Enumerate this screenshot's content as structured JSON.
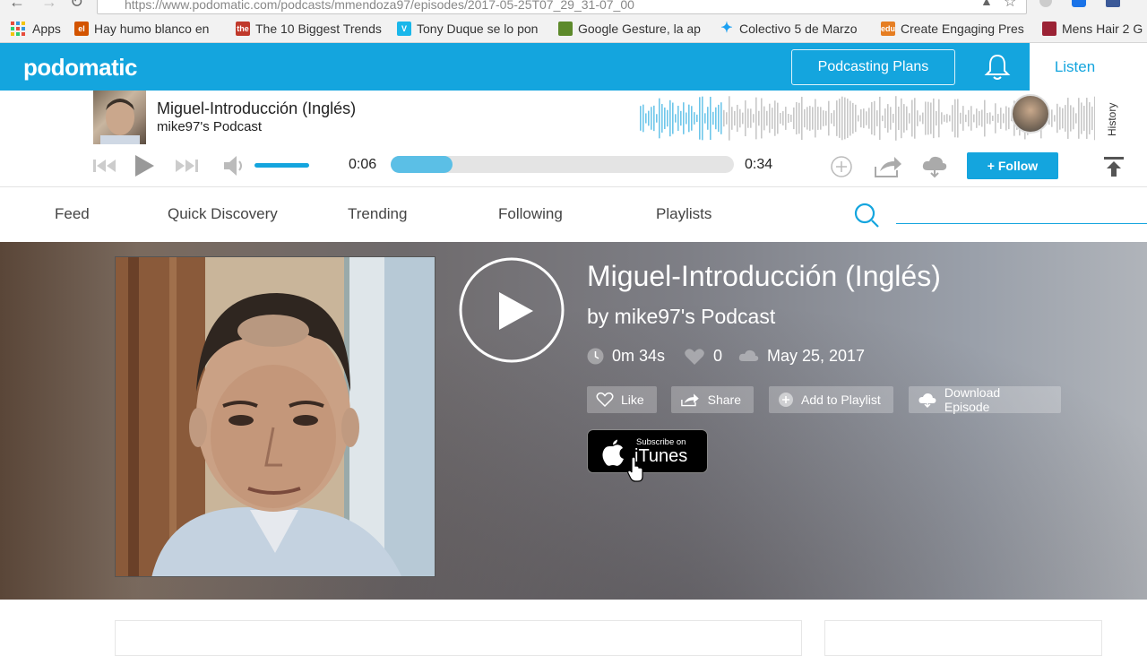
{
  "browser": {
    "url": "https://www.podomatic.com/podcasts/mmendoza97/episodes/2017-05-25T07_29_31-07_00",
    "bookmarks": [
      {
        "label": "Apps",
        "icon": "apps-grid-icon",
        "color": "#4285f4"
      },
      {
        "label": "Hay humo blanco en",
        "icon": "el-favicon",
        "color": "#d35400"
      },
      {
        "label": "The 10 Biggest Trends",
        "icon": "the-favicon",
        "color": "#c0392b"
      },
      {
        "label": "Tony Duque se lo pon",
        "icon": "vimeo-icon",
        "color": "#1ab7ea"
      },
      {
        "label": "Google Gesture, la ap",
        "icon": "app-favicon",
        "color": "#5d8a2b"
      },
      {
        "label": "Colectivo 5 de Marzo",
        "icon": "twitter-icon",
        "color": "#1da1f2"
      },
      {
        "label": "Create Engaging Pres",
        "icon": "edu-favicon",
        "color": "#e67e22"
      },
      {
        "label": "Mens Hair 2 G",
        "icon": "mens-hair-favicon",
        "color": "#9b2335"
      }
    ]
  },
  "header": {
    "logo": "podomatic",
    "plans_label": "Podcasting Plans",
    "listen_label": "Listen"
  },
  "mini_player": {
    "title": "Miguel-Introducción (Inglés)",
    "podcast": "mike97's Podcast",
    "history_label": "History"
  },
  "controls": {
    "current_time": "0:06",
    "end_time": "0:34",
    "progress": 0.18,
    "volume": 1.0,
    "follow_label": "+ Follow"
  },
  "nav": {
    "items": [
      "Feed",
      "Quick Discovery",
      "Trending",
      "Following",
      "Playlists"
    ],
    "search_placeholder": ""
  },
  "episode": {
    "title": "Miguel-Introducción (Inglés)",
    "by_line": "by mike97's Podcast",
    "duration": "0m 34s",
    "likes": "0",
    "date": "May 25, 2017",
    "actions": {
      "like": "Like",
      "share": "Share",
      "add_to_playlist": "Add to Playlist",
      "download": "Download Episode"
    },
    "itunes": {
      "small": "Subscribe on",
      "big": "iTunes"
    }
  },
  "colors": {
    "brand": "#14a5de",
    "progress_fill": "#5bbfe6"
  }
}
